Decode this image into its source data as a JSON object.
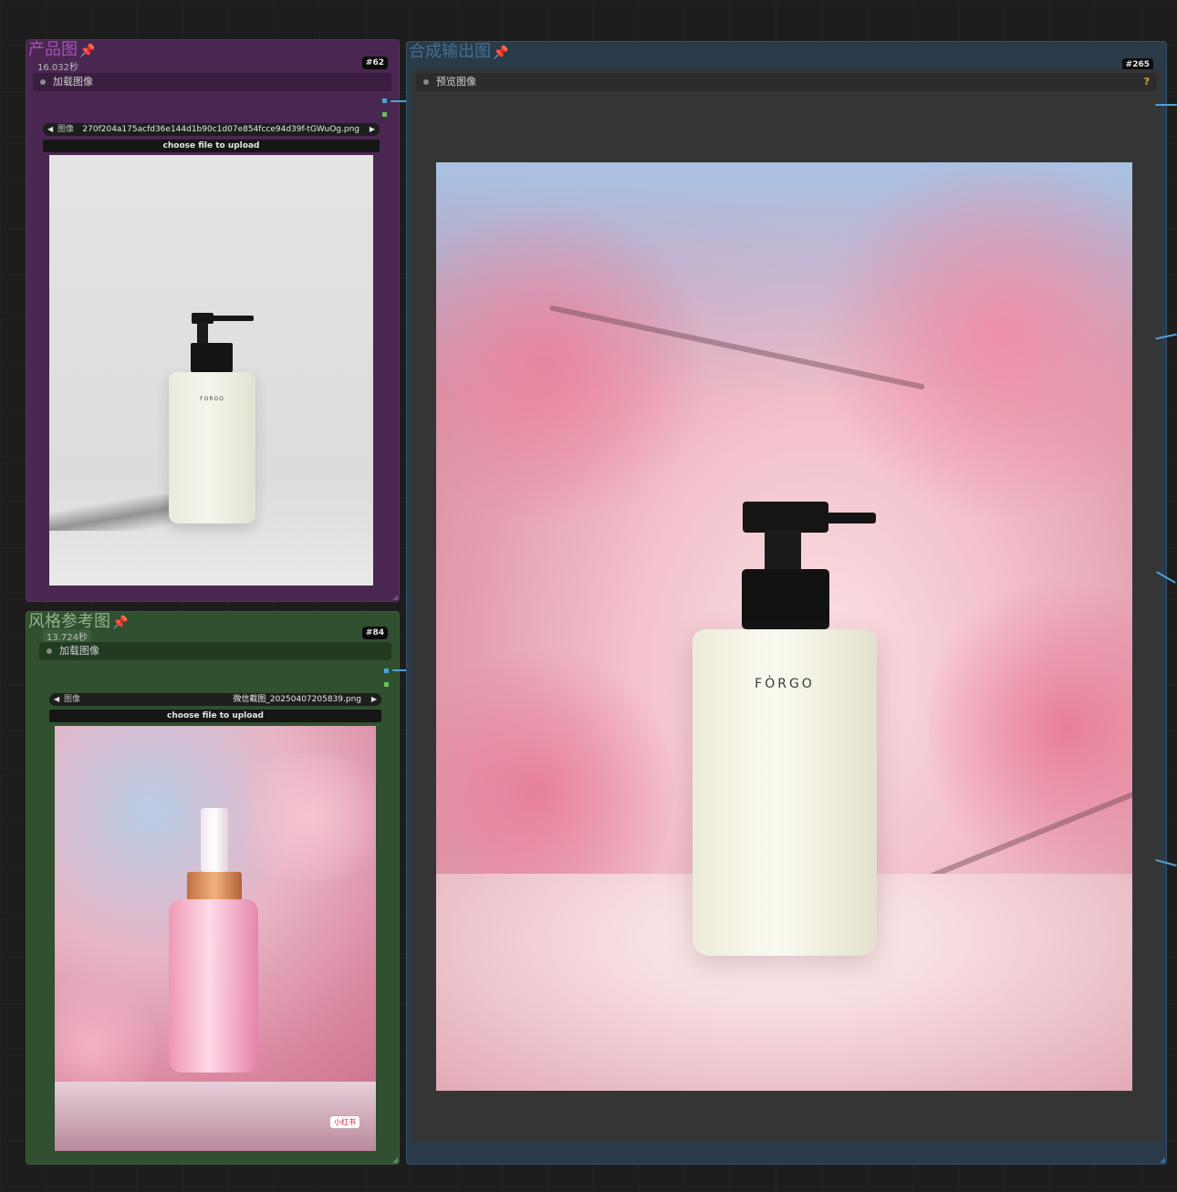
{
  "colors": {
    "product_node_bg": "#4a2750",
    "product_title": "#a453b6",
    "style_node_bg": "#30502f",
    "style_title": "#8fb38c",
    "output_node_bg": "#2b3a48",
    "output_title": "#3f6f93",
    "wire": "#4aa3d8"
  },
  "product_node": {
    "title": "产品图",
    "timer": "16.032秒",
    "badge": "#62",
    "slot_label": "加载图像",
    "widget_label": "图像",
    "widget_value": "270f204a175acfd36e144d1b90c1d07e854fcce94d39f-tGWuOg.png",
    "upload_label": "choose file to upload",
    "image_brand": "FORGO"
  },
  "style_node": {
    "title": "风格参考图",
    "timer": "13.724秒",
    "badge": "#84",
    "slot_label": "加载图像",
    "widget_label": "图像",
    "widget_value": "微信截图_20250407205839.png",
    "upload_label": "choose file to upload",
    "watermark": "小红书"
  },
  "output_node": {
    "title": "合成输出图",
    "badge": "#265",
    "slot_label": "预览图像",
    "help_icon": "?",
    "image_brand": "FÒRGO"
  },
  "icons": {
    "pin": "pin-icon",
    "left_arrow": "arrow-left-icon",
    "right_arrow": "arrow-right-icon"
  }
}
